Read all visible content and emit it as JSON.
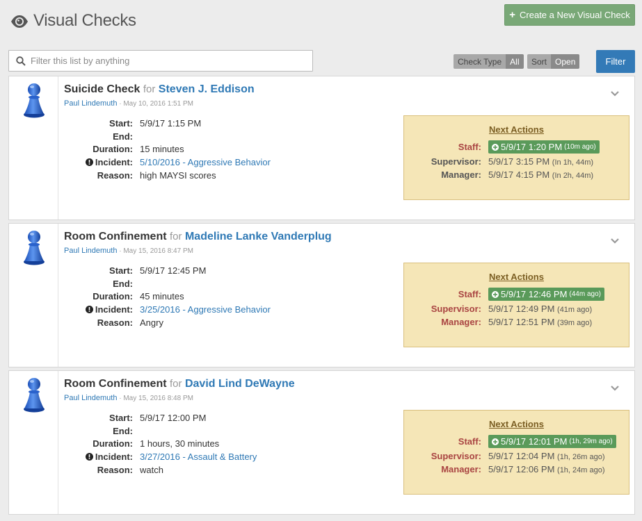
{
  "header": {
    "title": "Visual Checks",
    "create_label": "Create a New Visual Check"
  },
  "filters": {
    "search_placeholder": "Filter this list by anything",
    "check_type_label": "Check Type",
    "check_type_value": "All",
    "sort_label": "Sort",
    "sort_value": "Open",
    "filter_label": "Filter"
  },
  "labels": {
    "for": "for",
    "start": "Start:",
    "end": "End:",
    "duration": "Duration:",
    "incident": "Incident:",
    "reason": "Reason:",
    "next_actions": "Next Actions",
    "staff": "Staff:",
    "supervisor": "Supervisor:",
    "manager": "Manager:"
  },
  "checks": [
    {
      "type": "Suicide Check",
      "person": "Steven J. Eddison",
      "author": "Paul Lindemuth",
      "created": "· May 10, 2016 1:51 PM",
      "start": "5/9/17 1:15 PM",
      "end": "",
      "duration": "15 minutes",
      "incident": "5/10/2016 - Aggressive Behavior",
      "reason": "high MAYSI scores",
      "staff": {
        "time": "5/9/17 1:20 PM",
        "rel": "(10m ago)"
      },
      "supervisor": {
        "time": "5/9/17 3:15 PM",
        "rel": "(In 1h, 44m)"
      },
      "manager": {
        "time": "5/9/17 4:15 PM",
        "rel": "(In 2h, 44m)"
      }
    },
    {
      "type": "Room Confinement",
      "person": "Madeline Lanke Vanderplug",
      "author": "Paul Lindemuth",
      "created": "· May 15, 2016 8:47 PM",
      "start": "5/9/17 12:45 PM",
      "end": "",
      "duration": "45 minutes",
      "incident": "3/25/2016 - Aggressive Behavior",
      "reason": "Angry",
      "staff": {
        "time": "5/9/17 12:46 PM",
        "rel": "(44m ago)"
      },
      "supervisor": {
        "time": "5/9/17 12:49 PM",
        "rel": "(41m ago)"
      },
      "manager": {
        "time": "5/9/17 12:51 PM",
        "rel": "(39m ago)"
      }
    },
    {
      "type": "Room Confinement",
      "person": "David Lind DeWayne",
      "author": "Paul Lindemuth",
      "created": "· May 15, 2016 8:48 PM",
      "start": "5/9/17 12:00 PM",
      "end": "",
      "duration": "1 hours, 30 minutes",
      "incident": "3/27/2016 - Assault & Battery",
      "reason": "watch",
      "staff": {
        "time": "5/9/17 12:01 PM",
        "rel": "(1h, 29m ago)"
      },
      "supervisor": {
        "time": "5/9/17 12:04 PM",
        "rel": "(1h, 26m ago)"
      },
      "manager": {
        "time": "5/9/17 12:06 PM",
        "rel": "(1h, 24m ago)"
      }
    }
  ],
  "colors": {
    "accent_blue": "#2f79b5",
    "create_green": "#79a877",
    "staff_badge_green": "#5a9a5a",
    "actions_bg": "#f5e6b7",
    "overdue_red": "#a94442"
  }
}
